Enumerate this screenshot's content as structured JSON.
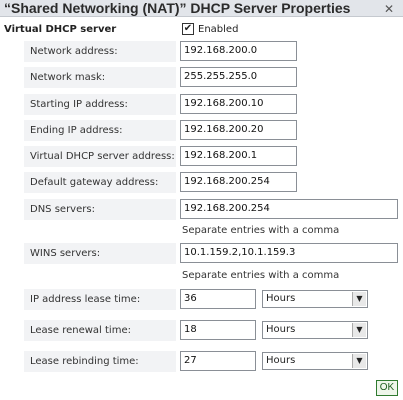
{
  "dialog": {
    "title": "“Shared Networking (NAT)” DHCP Server Properties",
    "close_glyph": "✕"
  },
  "section": {
    "label": "Virtual DHCP server",
    "enabled_label": "Enabled",
    "enabled_checked": true,
    "check_glyph": "✔"
  },
  "fields": {
    "network_address": {
      "label": "Network address:",
      "value": "192.168.200.0"
    },
    "network_mask": {
      "label": "Network mask:",
      "value": "255.255.255.0"
    },
    "starting_ip": {
      "label": "Starting IP address:",
      "value": "192.168.200.10"
    },
    "ending_ip": {
      "label": "Ending IP address:",
      "value": "192.168.200.20"
    },
    "dhcp_server_address": {
      "label": "Virtual DHCP server address:",
      "value": "192.168.200.1"
    },
    "default_gateway": {
      "label": "Default gateway address:",
      "value": "192.168.200.254"
    },
    "dns_servers": {
      "label": "DNS servers:",
      "value": "192.168.200.254",
      "hint": "Separate entries with a comma"
    },
    "wins_servers": {
      "label": "WINS servers:",
      "value": "10.1.159.2,10.1.159.3",
      "hint": "Separate entries with a comma"
    },
    "lease_time": {
      "label": "IP address lease time:",
      "value": "36",
      "unit": "Hours"
    },
    "renewal_time": {
      "label": "Lease renewal time:",
      "value": "18",
      "unit": "Hours"
    },
    "rebinding_time": {
      "label": "Lease rebinding time:",
      "value": "27",
      "unit": "Hours"
    }
  },
  "icons": {
    "dropdown": "chevron-down-icon",
    "close": "close-icon",
    "check": "check-icon"
  },
  "dropdown_glyph": "▼",
  "buttons": {
    "ok_label": "OK"
  }
}
